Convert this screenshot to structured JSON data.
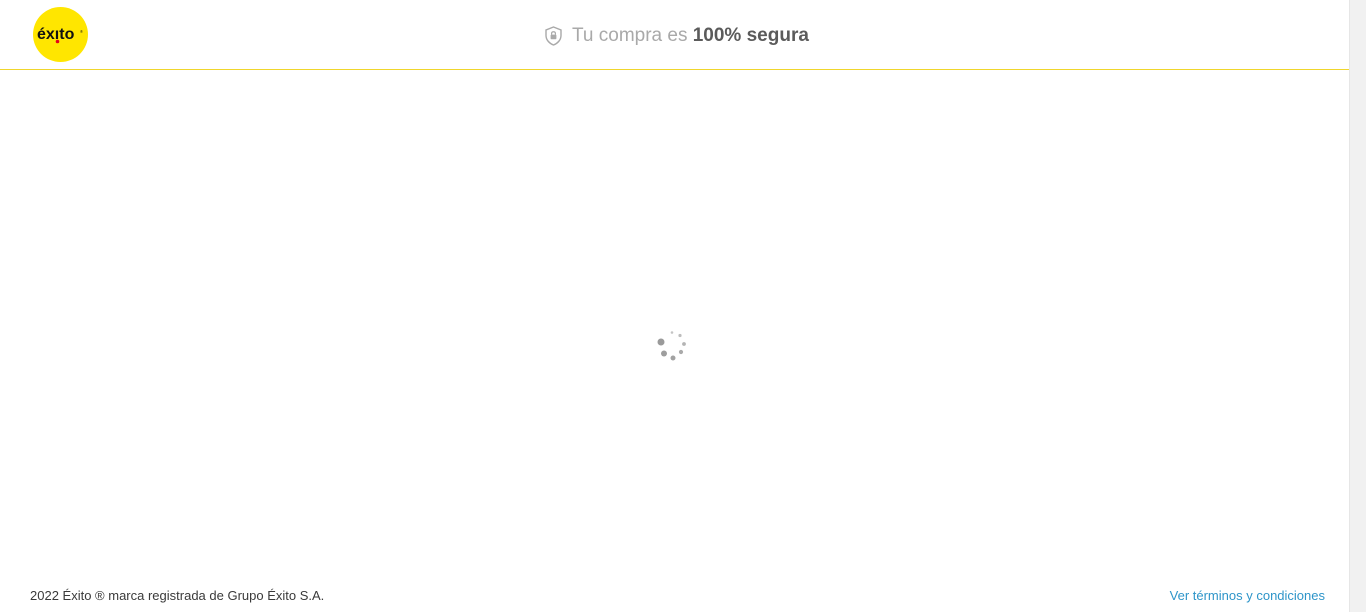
{
  "header": {
    "logo_text": "éxito",
    "secure_prefix": "Tu compra es",
    "secure_strong": "100% segura"
  },
  "main": {
    "loading_icon": "loading-spinner-icon"
  },
  "footer": {
    "copyright": "2022 Éxito ® marca registrada de Grupo Éxito S.A.",
    "terms_link": "Ver términos y condiciones"
  },
  "colors": {
    "brand_yellow": "#ffe600",
    "header_border": "#f0d62c",
    "link_blue": "#2e95c9",
    "muted_text": "#a9a9a9",
    "strong_text": "#5b5b5b"
  }
}
